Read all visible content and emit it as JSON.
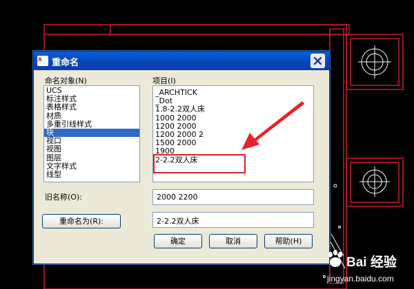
{
  "dialog": {
    "title": "重命名",
    "app_icon_text": "A",
    "left_panel": {
      "label": "命名对象(N)",
      "items": [
        "UCS",
        "标注样式",
        "表格样式",
        "材质",
        "多重引线样式",
        "块",
        "视口",
        "视图",
        "图层",
        "文字样式",
        "线型"
      ],
      "selected_index": 5
    },
    "right_panel": {
      "label": "项目(I)",
      "items": [
        "_ARCHTICK",
        "_Dot",
        "1.8-2.2双人床",
        "1000 2000",
        "1200 2000",
        "1200 2000 2",
        "1500 2000",
        "1900",
        "2-2.2双人床"
      ]
    },
    "old_name": {
      "label": "旧名称(O):",
      "value": "2000 2200"
    },
    "rename_to": {
      "button_label": "重命名为(R):",
      "value": "2-2.2双人床"
    },
    "buttons": {
      "ok": "确定",
      "cancel": "取消",
      "help": "帮助(H)"
    }
  },
  "watermark": {
    "brand": "Bai 经验",
    "url": "jingyan.baidu.com"
  },
  "colors": {
    "cad_red": "#d8202a",
    "selection": "#316ac5",
    "title_bar": "#0a5fd8",
    "annotation": "#e8202a"
  }
}
